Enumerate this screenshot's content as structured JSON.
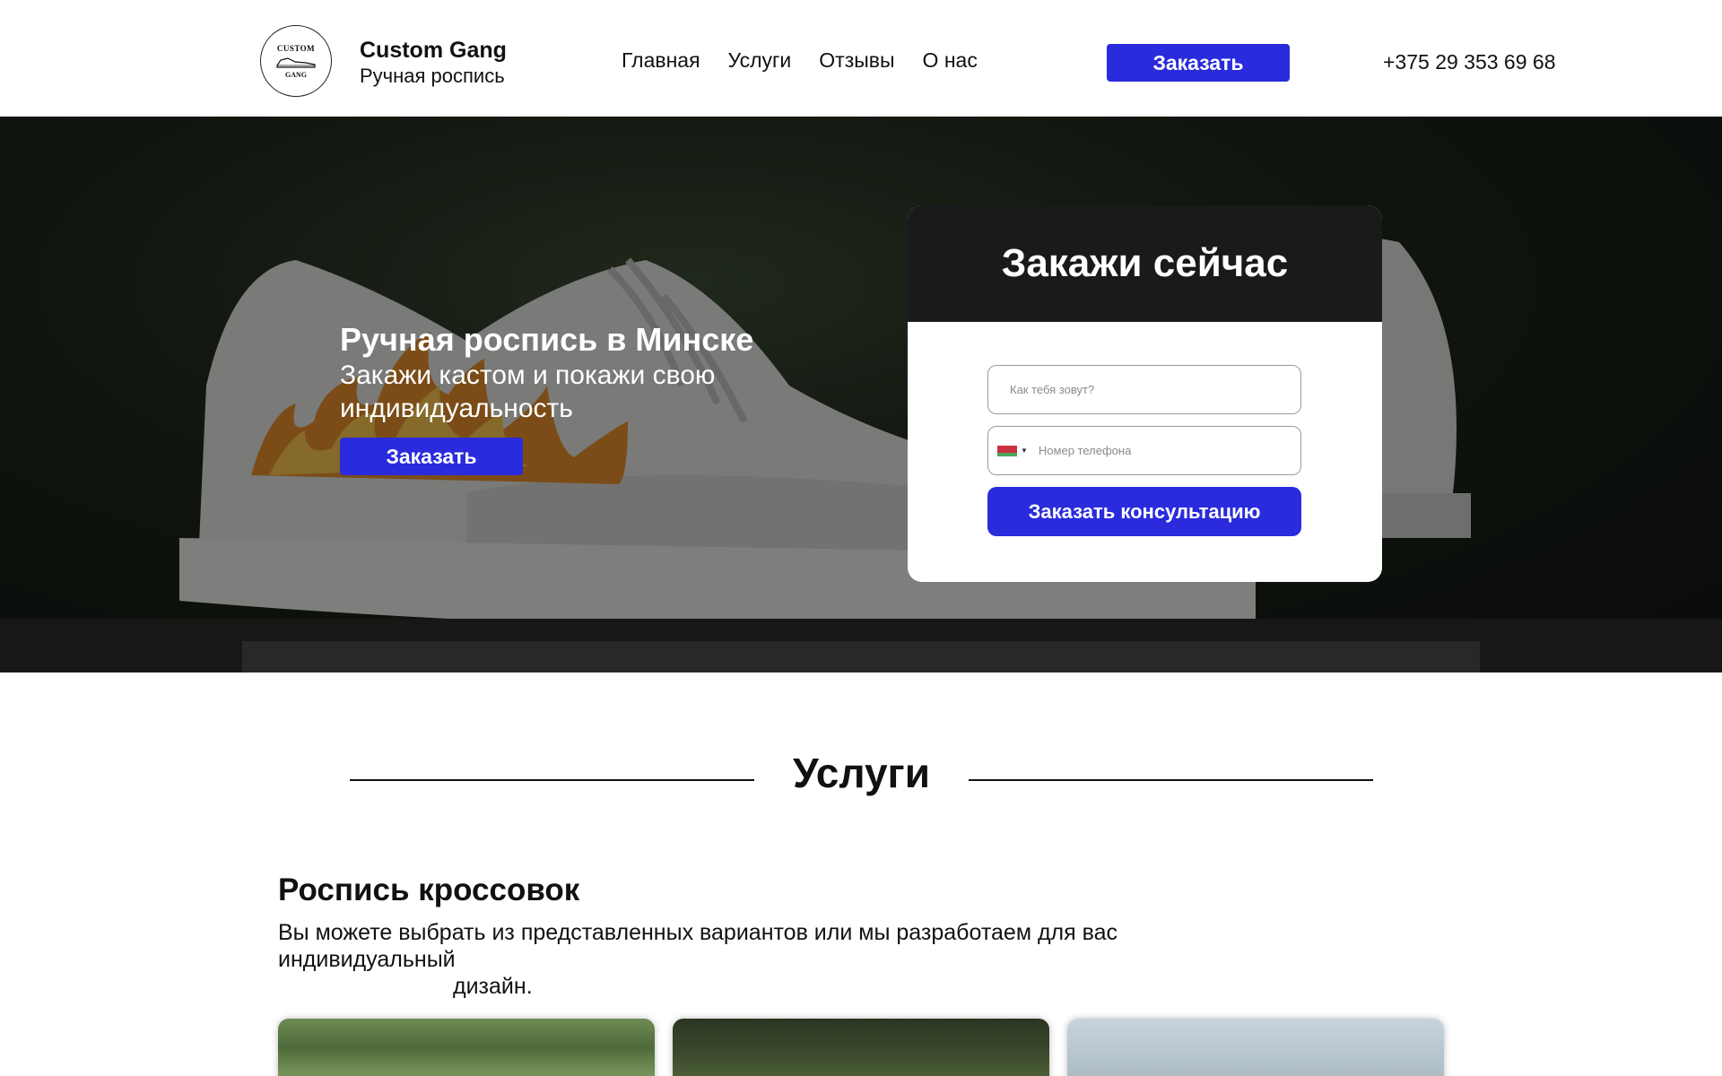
{
  "header": {
    "logo_top_text": "CUSTOM",
    "logo_bottom_text": "GANG",
    "brand_name": "Custom Gang",
    "brand_subtitle": "Ручная роспись",
    "nav": [
      {
        "label": "Главная"
      },
      {
        "label": "Услуги"
      },
      {
        "label": "Отзывы"
      },
      {
        "label": "О нас"
      }
    ],
    "order_button": "Заказать",
    "phone": "+375 29 353 69 68"
  },
  "hero": {
    "title": "Ручная роспись в Минске",
    "subtitle": "Закажи кастом и покажи свою индивидуальность",
    "order_button": "Заказать"
  },
  "form": {
    "title": "Закажи сейчас",
    "name_placeholder": "Как тебя зовут?",
    "name_value": "",
    "phone_placeholder": "Номер телефона",
    "phone_value": "",
    "country_flag": "belarus-flag-icon",
    "submit_button": "Заказать консультацию"
  },
  "services": {
    "section_title": "Услуги",
    "item_title": "Роспись кроссовок",
    "item_desc_line1": "Вы можете выбрать из представленных вариантов или мы разработаем для вас индивидуальный",
    "item_desc_line2": "дизайн."
  },
  "colors": {
    "accent": "#2a2bdc",
    "form_header": "#1a1a1a"
  }
}
